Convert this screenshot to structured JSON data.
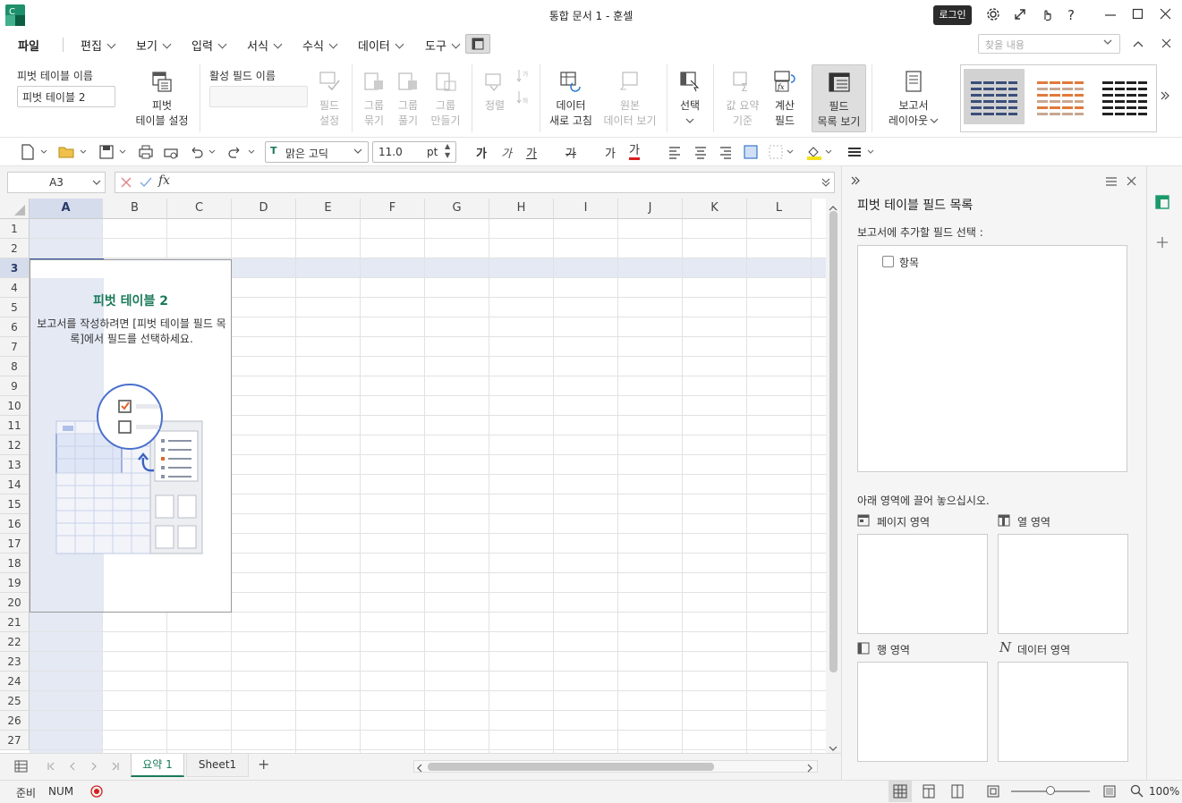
{
  "window": {
    "title": "통합 문서 1 - 훈셀",
    "login_label": "로그인",
    "app_letter": "C"
  },
  "menu": {
    "file": "파일",
    "items": [
      "편집",
      "보기",
      "입력",
      "서식",
      "수식",
      "데이터",
      "도구"
    ],
    "search_placeholder": "찾을 내용"
  },
  "ribbon": {
    "pivot_name_label": "피벗 테이블 이름",
    "pivot_name_value": "피벗 테이블 2",
    "pivot_settings": [
      "피벗",
      "테이블 설정"
    ],
    "active_field_label": "활성 필드 이름",
    "active_field_value": "",
    "field_settings": [
      "필드",
      "설정"
    ],
    "group_collapse": [
      "그룹",
      "묶기"
    ],
    "group_expand": [
      "그룹",
      "풀기"
    ],
    "group_make": [
      "그룹",
      "만들기"
    ],
    "sort": "정렬",
    "refresh": [
      "데이터",
      "새로 고침"
    ],
    "source": [
      "원본",
      "데이터 보기"
    ],
    "select": "선택",
    "value_basis": [
      "값 요약",
      "기준"
    ],
    "calc_field": [
      "계산",
      "필드"
    ],
    "field_list": [
      "필드",
      "목록 보기"
    ],
    "report_layout": [
      "보고서",
      "레이아웃"
    ]
  },
  "toolbar": {
    "font": "맑은 고딕",
    "size": "11.0",
    "size_unit": "pt",
    "bold": "가",
    "italic": "가",
    "underline": "가",
    "strike": "가",
    "shadow": "가",
    "font_color": "가"
  },
  "formula_bar": {
    "cell_ref": "A3",
    "formula": ""
  },
  "grid": {
    "columns": [
      "A",
      "B",
      "C",
      "D",
      "E",
      "F",
      "G",
      "H",
      "I",
      "J",
      "K",
      "L"
    ],
    "rows": [
      "1",
      "2",
      "3",
      "4",
      "5",
      "6",
      "7",
      "8",
      "9",
      "10",
      "11",
      "12",
      "13",
      "14",
      "15",
      "16",
      "17",
      "18",
      "19",
      "20",
      "21",
      "22",
      "23",
      "24",
      "25",
      "26",
      "27"
    ],
    "selected_cell": "A3"
  },
  "pivot": {
    "title": "피벗 테이블 2",
    "desc": "보고서를 작성하려면 [피벗 테이블 필드 목록]에서 필드를 선택하세요."
  },
  "tabs": {
    "items": [
      "요약 1",
      "Sheet1"
    ],
    "active": "요약 1",
    "add": "+"
  },
  "field_panel": {
    "title": "피벗 테이블 필드 목록",
    "subtitle": "보고서에 추가할 필드 선택 :",
    "fields": [
      "항목"
    ],
    "drop_hint": "아래 영역에 끌어 놓으십시오.",
    "page_area": "페이지 영역",
    "col_area": "열 영역",
    "row_area": "행 영역",
    "data_area": "데이터 영역",
    "data_symbol": "N"
  },
  "status": {
    "ready": "준비",
    "num": "NUM",
    "zoom": "100%",
    "zoom_level": 0.5
  }
}
